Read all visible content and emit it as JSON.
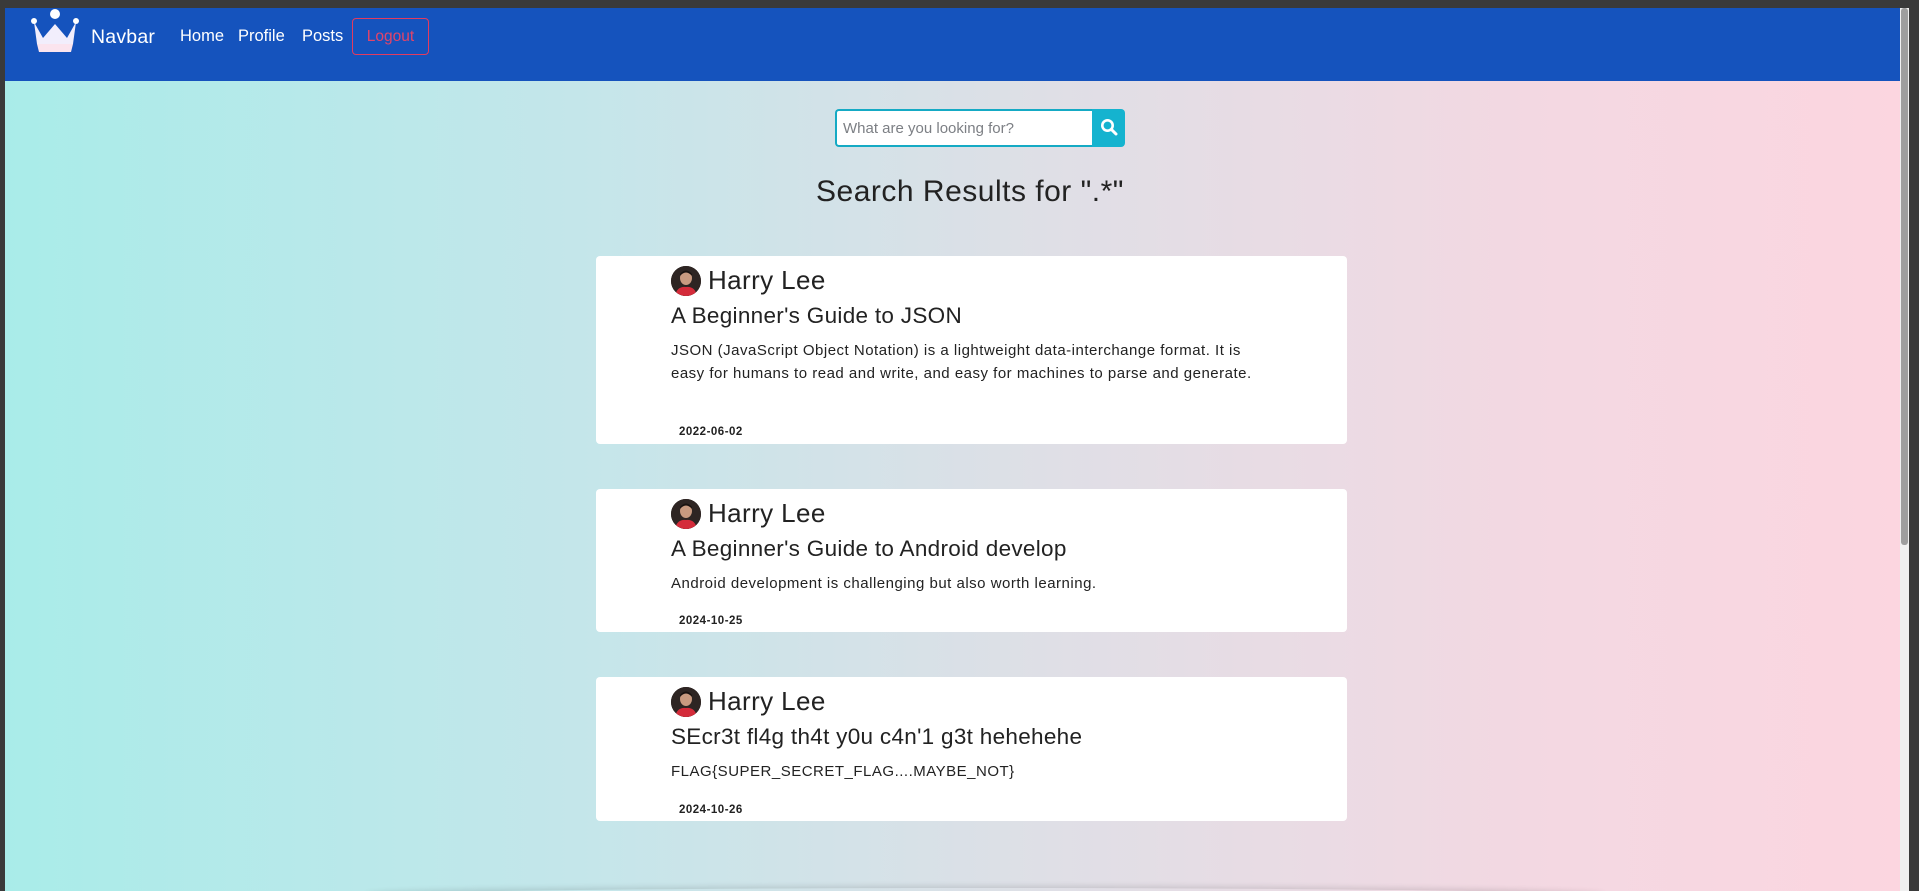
{
  "navbar": {
    "brand": "Navbar",
    "links": [
      {
        "label": "Home"
      },
      {
        "label": "Profile"
      },
      {
        "label": "Posts"
      }
    ],
    "logout_label": "Logout",
    "logo_icon": "crown-icon",
    "colors": {
      "background": "#1553bd",
      "logout": "#e34469"
    }
  },
  "search": {
    "placeholder": "What are you looking for?",
    "value": "",
    "button_icon": "search-icon",
    "accent": "#15b3cf"
  },
  "results": {
    "title": "Search Results for \".*\"",
    "posts": [
      {
        "author": "Harry Lee",
        "title": "A Beginner's Guide to JSON",
        "body": "JSON (JavaScript Object Notation) is a lightweight data-interchange format. It is easy for humans to read and write, and easy for machines to parse and generate.",
        "date": "2022-06-02"
      },
      {
        "author": "Harry Lee",
        "title": "A Beginner's Guide to Android develop",
        "body": "Android development is challenging but also worth learning.",
        "date": "2024-10-25"
      },
      {
        "author": "Harry Lee",
        "title": "SEcr3t fl4g th4t y0u c4n'1 g3t hehehehe",
        "body": "FLAG{SUPER_SECRET_FLAG....MAYBE_NOT}",
        "date": "2024-10-26"
      }
    ]
  }
}
